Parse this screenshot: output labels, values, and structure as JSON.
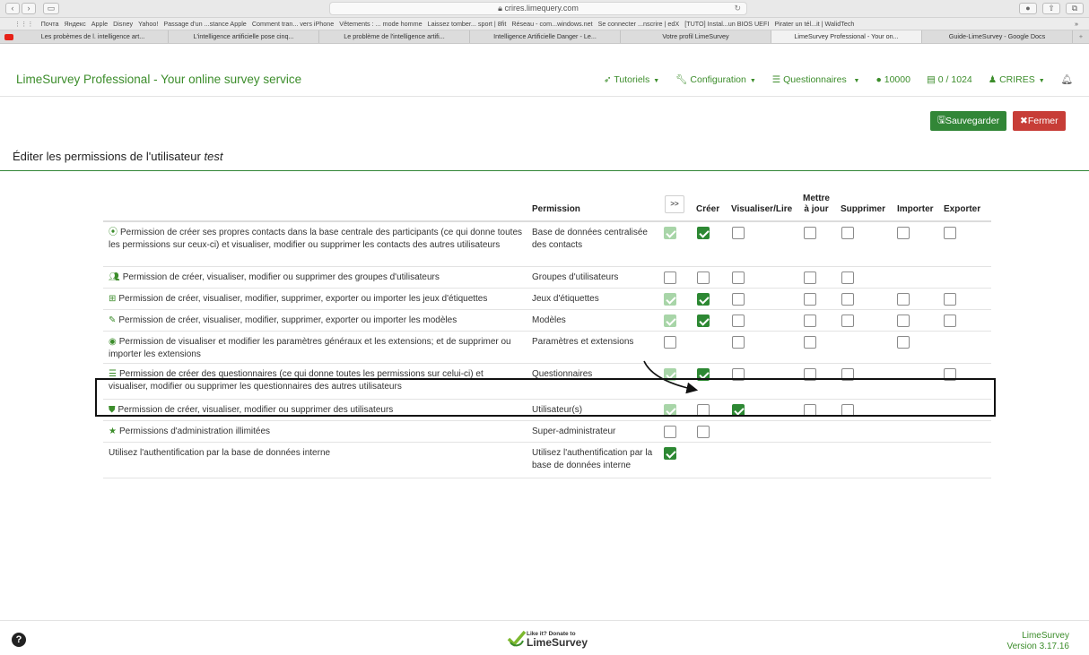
{
  "browser": {
    "address": "crires.limequery.com",
    "bookmarks": [
      "Почта",
      "Яндекс",
      "Apple",
      "Disney",
      "Yahoo!",
      "Passage d'un ...stance Apple",
      "Comment tran... vers iPhone",
      "Vêtements : ... mode homme",
      "Laissez tomber... sport | 8fit",
      "Réseau - com...windows.net",
      "Se connecter ...nscrire | edX",
      "[TUTO] Instal...un BIOS UEFI",
      "Pirater un tél...it | WalidTech"
    ],
    "tabs": [
      "Les probèmes de l. intelligence art...",
      "L'intelligence artificielle pose cinq...",
      "Le problème de l'intelligence artifi...",
      "Intelligence Artificielle Danger - Le...",
      "Votre profil LimeSurvey",
      "LimeSurvey Professional - Your on...",
      "Guide-LimeSurvey - Google Docs"
    ],
    "active_tab": 5
  },
  "header": {
    "brand": "LimeSurvey Professional - Your online survey service",
    "menu": {
      "tutorials": "Tutoriels",
      "configuration": "Configuration",
      "surveys": "Questionnaires",
      "responses": "10000",
      "storage": "0 / 1024",
      "user": "CRIRES"
    }
  },
  "actions": {
    "save": "Sauvegarder",
    "close": "Fermer"
  },
  "page": {
    "title_prefix": "Éditer les permissions de l'utilisateur",
    "username": "test"
  },
  "table": {
    "headers": {
      "permission": "Permission",
      "toggle": ">>",
      "create": "Créer",
      "read": "Visualiser/Lire",
      "update": "Mettre à jour",
      "delete": "Supprimer",
      "import": "Importer",
      "export": "Exporter"
    },
    "rows": [
      {
        "icon": "participants-icon",
        "desc": "Permission de créer ses propres contacts dans la base centrale des participants (ce qui donne toutes les permissions sur ceux-ci) et visualiser, modifier ou supprimer les contacts des autres utilisateurs",
        "perm": "Base de données centralisée des contacts",
        "checks": {
          "all": "dis",
          "create": "on",
          "read": "off",
          "update": "off",
          "delete": "off",
          "import": "off",
          "export": "off"
        }
      },
      {
        "icon": "user-groups-icon",
        "desc": "Permission de créer, visualiser, modifier ou supprimer des groupes d'utilisateurs",
        "perm": "Groupes d'utilisateurs",
        "checks": {
          "all": "off",
          "create": "off",
          "read": "off",
          "update": "off",
          "delete": "off"
        }
      },
      {
        "icon": "label-sets-icon",
        "desc": "Permission de créer, visualiser, modifier, supprimer, exporter ou importer les jeux d'étiquettes",
        "perm": "Jeux d'étiquettes",
        "checks": {
          "all": "dis",
          "create": "on",
          "read": "off",
          "update": "off",
          "delete": "off",
          "import": "off",
          "export": "off"
        }
      },
      {
        "icon": "templates-icon",
        "desc": "Permission de créer, visualiser, modifier, supprimer, exporter ou importer les modèles",
        "perm": "Modèles",
        "checks": {
          "all": "dis",
          "create": "on",
          "read": "off",
          "update": "off",
          "delete": "off",
          "import": "off",
          "export": "off"
        }
      },
      {
        "icon": "settings-icon",
        "desc": "Permission de visualiser et modifier les paramètres généraux et les extensions; et de supprimer ou importer les extensions",
        "perm": "Paramètres et extensions",
        "checks": {
          "all": "off",
          "read": "off",
          "update": "off",
          "import": "off"
        }
      },
      {
        "icon": "surveys-icon",
        "desc": "Permission de créer des questionnaires (ce qui donne toutes les permissions sur celui-ci) et visualiser, modifier ou supprimer les questionnaires des autres utilisateurs",
        "perm": "Questionnaires",
        "checks": {
          "all": "dis",
          "create": "on",
          "read": "off",
          "update": "off",
          "delete": "off",
          "export": "off"
        }
      },
      {
        "icon": "users-shield-icon",
        "desc": "Permission de créer, visualiser, modifier ou supprimer des utilisateurs",
        "perm": "Utilisateur(s)",
        "checks": {
          "all": "dis",
          "create": "off",
          "read": "on",
          "update": "off",
          "delete": "off"
        }
      },
      {
        "icon": "star-icon",
        "desc": "Permissions d'administration illimitées",
        "perm": "Super-administrateur",
        "checks": {
          "all": "off",
          "create": "off"
        }
      },
      {
        "icon": "",
        "desc": "Utilisez l'authentification par la base de données interne",
        "perm": "Utilisez l'authentification par la base de données interne",
        "checks": {
          "all": "on"
        }
      }
    ]
  },
  "footer": {
    "donate_small_1": "Like it?",
    "donate_small_2": "Donate to",
    "donate_big": "LimeSurvey",
    "app_name": "LimeSurvey",
    "version": "Version 3.17.16"
  },
  "colors": {
    "brand_green": "#3c8d2b",
    "save_green": "#328637",
    "close_red": "#c73d37"
  }
}
